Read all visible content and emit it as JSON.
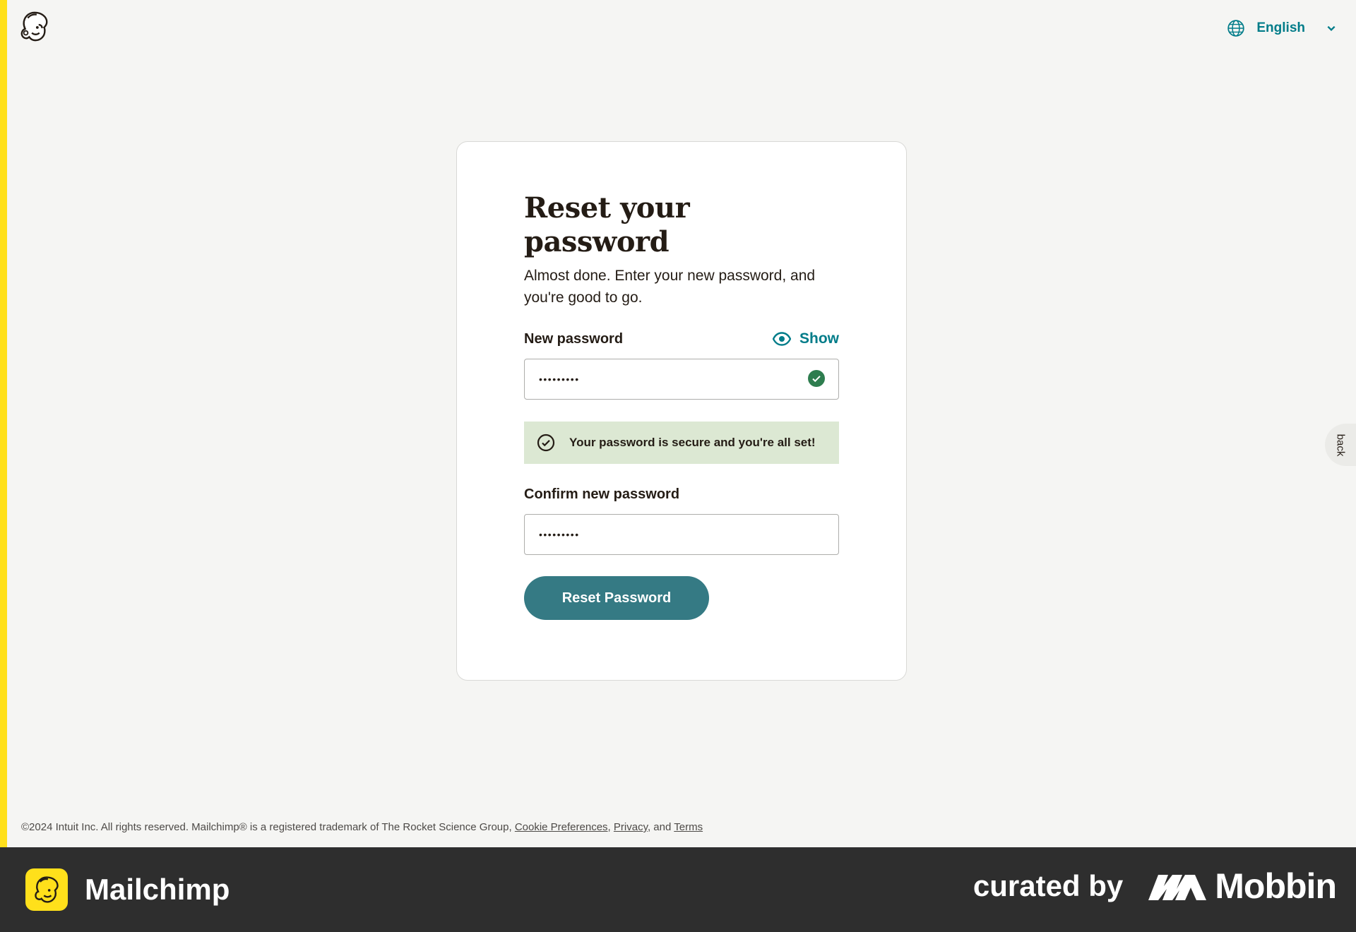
{
  "header": {
    "logo_icon": "mailchimp-freddie-logo",
    "language_icon": "globe-icon",
    "language_label": "English",
    "language_chevron_icon": "chevron-down-icon"
  },
  "card": {
    "title": "Reset your password",
    "subtitle": "Almost done. Enter your new password, and you're good to go.",
    "new_password": {
      "label": "New password",
      "show_label": "Show",
      "show_icon": "eye-icon",
      "value_masked": "•••••••••",
      "status_icon": "check-circle-icon"
    },
    "notice": {
      "icon": "check-circle-outline-icon",
      "text": "Your password is secure and you're all set!"
    },
    "confirm_password": {
      "label": "Confirm new password",
      "value_masked": "•••••••••"
    },
    "submit_label": "Reset Password"
  },
  "feedback_tab": {
    "label": "back"
  },
  "footer": {
    "legal_text": "©2024 Intuit Inc. All rights reserved. Mailchimp® is a registered trademark of The Rocket Science Group,",
    "cookie_link": "Cookie Preferences",
    "sep1": ",",
    "privacy_link": "Privacy",
    "sep2": ", and",
    "terms_link": "Terms"
  },
  "brand_bar": {
    "app_icon": "mailchimp-app-icon",
    "app_name": "Mailchimp",
    "curated_text": "curated by",
    "mobbin_logo": "mobbin-logo",
    "mobbin_name": "Mobbin"
  },
  "colors": {
    "accent": "#007c89",
    "button": "#357a84",
    "success_bg": "#dce8d3",
    "success_icon": "#2e7d4f",
    "brand_yellow": "#ffe01b",
    "brand_bar": "#2e2e2e",
    "page_bg": "#f5f5f3"
  }
}
